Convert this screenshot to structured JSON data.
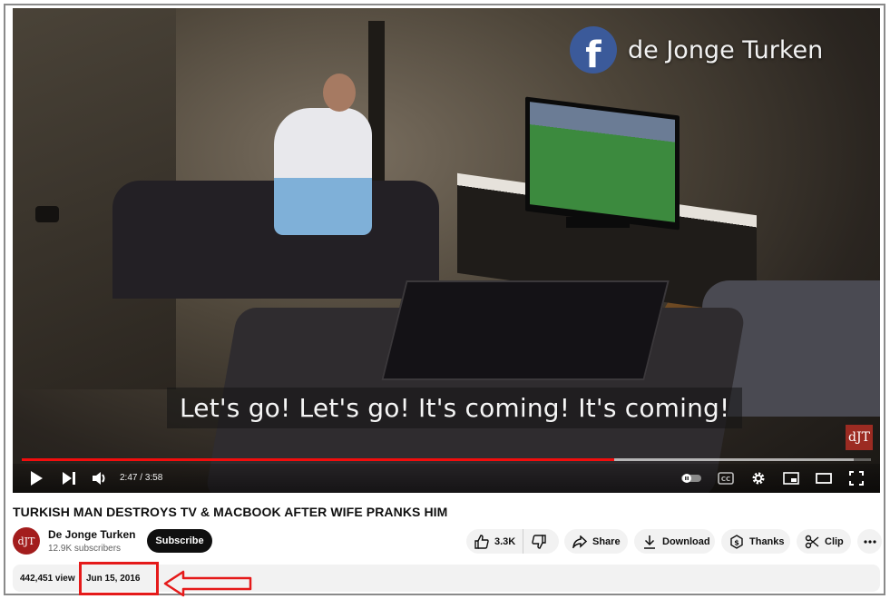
{
  "video": {
    "overlay_channel": "de Jonge Turken",
    "facebook_glyph": "f",
    "subtitle": "Let's go! Let's go! It's coming! It's coming!",
    "watermark": "dJT",
    "time_current": "2:47",
    "time_separator": " / ",
    "time_total": "3:58",
    "progress_fraction": 0.698,
    "buffer_fraction": 0.98,
    "progress_color": "#f20d0d",
    "controls": [
      "play-icon",
      "next-icon",
      "volume-icon",
      "autoplay-toggle-icon",
      "captions-icon",
      "settings-gear-icon",
      "miniplayer-icon",
      "theater-mode-icon",
      "fullscreen-icon"
    ]
  },
  "title": "TURKISH MAN DESTROYS TV & MACBOOK AFTER WIFE PRANKS HIM",
  "channel": {
    "avatar_text": "dJT",
    "name": "De Jonge Turken",
    "subscribers": "12.9K subscribers",
    "subscribe_label": "Subscribe"
  },
  "actions": {
    "likes": "3.3K",
    "share": "Share",
    "download": "Download",
    "thanks": "Thanks",
    "clip": "Clip"
  },
  "description": {
    "views": "442,451 view",
    "date": "Jun 15, 2016"
  },
  "annotation_color": "#e51a1a"
}
